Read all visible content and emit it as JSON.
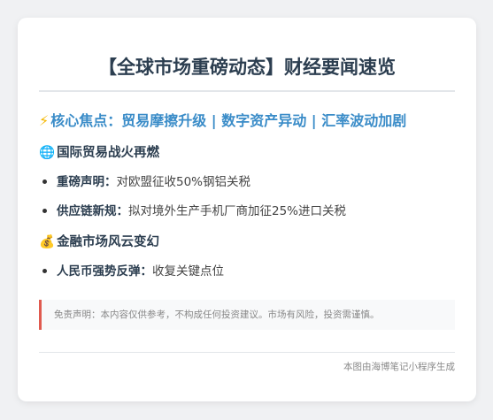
{
  "title": "【全球市场重磅动态】财经要闻速览",
  "focus": {
    "emoji": "⚡",
    "text": "核心焦点：贸易摩擦升级 | 数字资产异动 | 汇率波动加剧"
  },
  "sections": [
    {
      "emoji": "🌐",
      "heading": "国际贸易战火再燃",
      "items": [
        {
          "key": "重磅声明：",
          "value": "对欧盟征收50%钢铝关税"
        },
        {
          "key": "供应链新规：",
          "value": "拟对境外生产手机厂商加征25%进口关税"
        }
      ]
    },
    {
      "emoji": "💰",
      "heading": "金融市场风云变幻",
      "items": [
        {
          "key": "人民币强势反弹：",
          "value": "收复关键点位"
        }
      ]
    }
  ],
  "disclaimer": "免责声明：本内容仅供参考，不构成任何投资建议。市场有风险，投资需谨慎。",
  "footer": "本图由海博笔记小程序生成",
  "colors": {
    "title": "#2c3e50",
    "focus": "#3a8cc8",
    "disclaimer_border": "#e05a4f"
  }
}
